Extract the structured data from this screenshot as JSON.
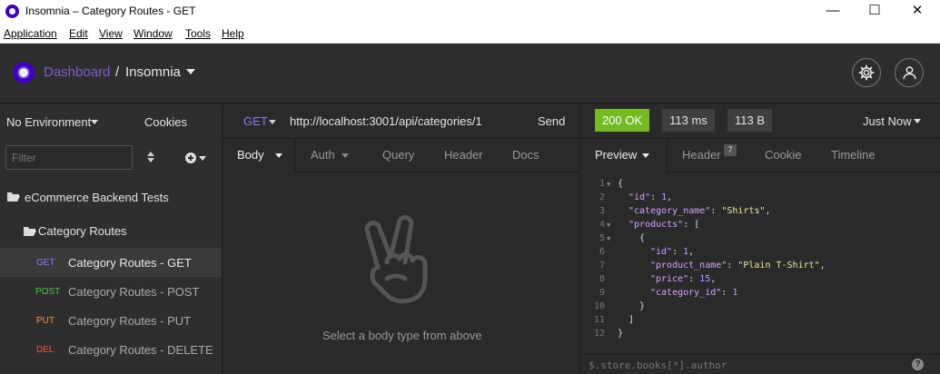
{
  "window": {
    "title": "Insomnia – Category Routes - GET",
    "minimize": "—",
    "maximize": "☐",
    "close": "✕"
  },
  "menu": [
    "Application",
    "Edit",
    "View",
    "Window",
    "Tools",
    "Help"
  ],
  "header": {
    "dashboard": "Dashboard",
    "separator": "/",
    "workspace": "Insomnia",
    "colors": {
      "accent": "#7f5bd4",
      "brand": "#4000bf"
    }
  },
  "sidebar": {
    "environment": "No Environment",
    "cookies": "Cookies",
    "filter_placeholder": "Filter",
    "workspace_folder": "eCommerce Backend Tests",
    "folder": "Category Routes",
    "requests": [
      {
        "method": "GET",
        "name": "Category Routes - GET",
        "color": "#8c7df0",
        "active": true
      },
      {
        "method": "POST",
        "name": "Category Routes - POST",
        "color": "#4ec94e",
        "active": false
      },
      {
        "method": "PUT",
        "name": "Category Routes - PUT",
        "color": "#ff9a1f",
        "active": false
      },
      {
        "method": "DEL",
        "name": "Category Routes - DELETE",
        "color": "#ff4f3f",
        "active": false
      }
    ]
  },
  "request": {
    "method": "GET",
    "url": "http://localhost:3001/api/categories/1",
    "send": "Send",
    "tabs": {
      "body": "Body",
      "auth": "Auth",
      "query": "Query",
      "header": "Header",
      "docs": "Docs"
    },
    "empty_message": "Select a body type from above"
  },
  "response": {
    "status": "200 OK",
    "time": "113 ms",
    "size": "113 B",
    "when": "Just Now",
    "tabs": {
      "preview": "Preview",
      "header": "Header",
      "header_count": "7",
      "cookie": "Cookie",
      "timeline": "Timeline"
    },
    "filter_placeholder": "$.store.books[*].author",
    "help": "?",
    "status_color": "#75ba24"
  },
  "code_lines": [
    {
      "n": "1",
      "fold": true,
      "indent": 0,
      "parts": [
        [
          "p",
          "{"
        ]
      ]
    },
    {
      "n": "2",
      "fold": false,
      "indent": 1,
      "parts": [
        [
          "k",
          "\"id\""
        ],
        [
          "p",
          ": "
        ],
        [
          "n",
          "1"
        ],
        [
          "p",
          ","
        ]
      ]
    },
    {
      "n": "3",
      "fold": false,
      "indent": 1,
      "parts": [
        [
          "k",
          "\"category_name\""
        ],
        [
          "p",
          ": "
        ],
        [
          "s",
          "\"Shirts\""
        ],
        [
          "p",
          ","
        ]
      ]
    },
    {
      "n": "4",
      "fold": true,
      "indent": 1,
      "parts": [
        [
          "k",
          "\"products\""
        ],
        [
          "p",
          ": ["
        ]
      ]
    },
    {
      "n": "5",
      "fold": true,
      "indent": 2,
      "parts": [
        [
          "p",
          "{"
        ]
      ]
    },
    {
      "n": "6",
      "fold": false,
      "indent": 3,
      "parts": [
        [
          "k",
          "\"id\""
        ],
        [
          "p",
          ": "
        ],
        [
          "n",
          "1"
        ],
        [
          "p",
          ","
        ]
      ]
    },
    {
      "n": "7",
      "fold": false,
      "indent": 3,
      "parts": [
        [
          "k",
          "\"product_name\""
        ],
        [
          "p",
          ": "
        ],
        [
          "s",
          "\"Plain T-Shirt\""
        ],
        [
          "p",
          ","
        ]
      ]
    },
    {
      "n": "8",
      "fold": false,
      "indent": 3,
      "parts": [
        [
          "k",
          "\"price\""
        ],
        [
          "p",
          ": "
        ],
        [
          "n",
          "15"
        ],
        [
          "p",
          ","
        ]
      ]
    },
    {
      "n": "9",
      "fold": false,
      "indent": 3,
      "parts": [
        [
          "k",
          "\"category_id\""
        ],
        [
          "p",
          ": "
        ],
        [
          "n",
          "1"
        ]
      ]
    },
    {
      "n": "10",
      "fold": false,
      "indent": 2,
      "parts": [
        [
          "p",
          "}"
        ]
      ]
    },
    {
      "n": "11",
      "fold": false,
      "indent": 1,
      "parts": [
        [
          "p",
          "]"
        ]
      ]
    },
    {
      "n": "12",
      "fold": false,
      "indent": 0,
      "parts": [
        [
          "p",
          "}"
        ]
      ]
    }
  ]
}
